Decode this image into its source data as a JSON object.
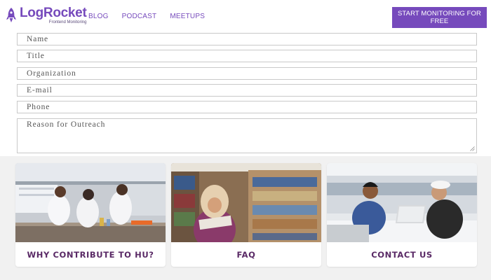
{
  "header": {
    "logo": {
      "name": "LogRocket",
      "subtitle": "Frontend Monitoring"
    },
    "nav": [
      {
        "label": "BLOG"
      },
      {
        "label": "PODCAST"
      },
      {
        "label": "MEETUPS"
      }
    ],
    "cta_label": "START MONITORING FOR FREE",
    "brand_color": "#764abc"
  },
  "form": {
    "fields": [
      {
        "placeholder": "Name"
      },
      {
        "placeholder": "Title"
      },
      {
        "placeholder": "Organization"
      },
      {
        "placeholder": "E-mail"
      },
      {
        "placeholder": "Phone"
      }
    ],
    "textarea_placeholder": "Reason for Outreach"
  },
  "cards": [
    {
      "label": "WHY CONTRIBUTE TO HU?",
      "image": "lab-researchers-photo"
    },
    {
      "label": "FAQ",
      "image": "library-reading-photo"
    },
    {
      "label": "CONTACT US",
      "image": "students-laptop-photo"
    }
  ],
  "colors": {
    "card_label": "#5a2a66",
    "section_bg": "#f1f1f1"
  }
}
